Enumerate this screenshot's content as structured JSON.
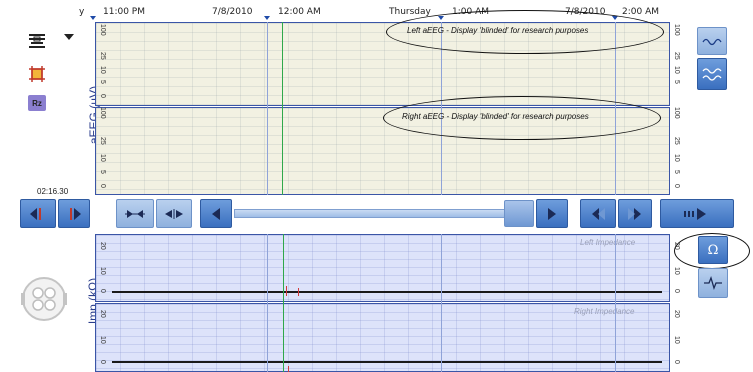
{
  "time_axis": {
    "labels": [
      {
        "text": "y"
      },
      {
        "text": "11:00 PM"
      },
      {
        "text": "7/8/2010"
      },
      {
        "text": "12:00 AM"
      },
      {
        "text": "Thursday"
      },
      {
        "text": "1:00 AM"
      },
      {
        "text": "7/8/2010"
      },
      {
        "text": "2:00 AM"
      }
    ]
  },
  "aeeg": {
    "axis_title": "aEEG (µV)",
    "left_ticks": [
      "100",
      "25",
      "10",
      "5",
      "0"
    ],
    "right_ticks": [
      "100",
      "25",
      "10",
      "5",
      "0"
    ],
    "left_annotation": "Left aEEG - Display 'blinded' for research purposes",
    "right_annotation": "Right aEEG - Display 'blinded' for research purposes"
  },
  "impedance": {
    "axis_title": "Imp (kΩ)",
    "ticks": [
      "20",
      "10",
      "0"
    ],
    "left_label": "Left Impedance",
    "right_label": "Right Impedance"
  },
  "cursor_time": "02:16.30",
  "colors": {
    "accent": "#3a6fbf",
    "cursor_green": "#2fa84a",
    "eeg_bg": "#f2f1e2",
    "imp_bg": "#dde3fa"
  }
}
